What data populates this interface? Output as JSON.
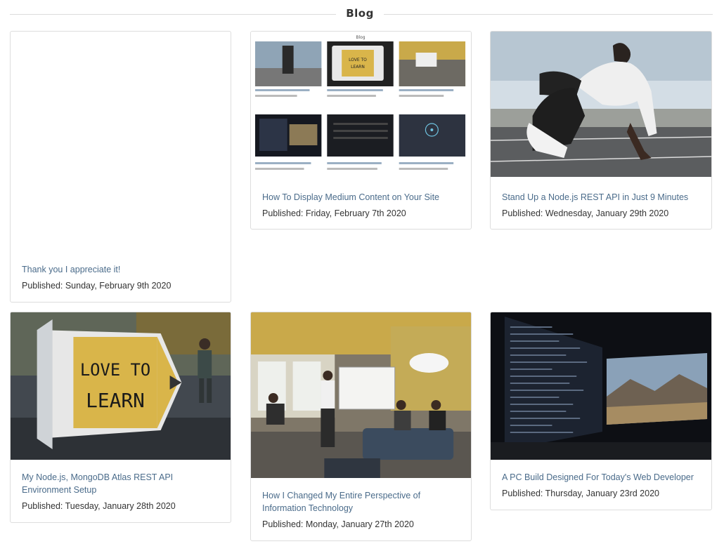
{
  "section": {
    "title": "Blog"
  },
  "posts": [
    {
      "title": "Thank you I appreciate it!",
      "published": "Published: Sunday, February 9th 2020",
      "image": "none"
    },
    {
      "title": "How To Display Medium Content on Your Site",
      "published": "Published: Friday, February 7th 2020",
      "image": "blog-grid-screenshot"
    },
    {
      "title": "Stand Up a Node.js REST API in Just 9 Minutes",
      "published": "Published: Wednesday, January 29th 2020",
      "image": "sprinter-on-track"
    },
    {
      "title": "My Node.js, MongoDB Atlas REST API Environment Setup",
      "published": "Published: Tuesday, January 28th 2020",
      "image": "love-to-learn-sign"
    },
    {
      "title": "How I Changed My Entire Perspective of Information Technology",
      "published": "Published: Monday, January 27th 2020",
      "image": "office-meeting"
    },
    {
      "title": "A PC Build Designed For Today's Web Developer",
      "published": "Published: Thursday, January 23rd 2020",
      "image": "dual-monitor-code"
    }
  ],
  "embedded_screenshot": {
    "heading": "Blog",
    "sign_text": "LOVE TO LEARN"
  },
  "sign": {
    "line1": "LOVE TO",
    "line2": "LEARN"
  },
  "colors": {
    "link": "#4a6b8a",
    "text": "#333333",
    "border": "#dddddd",
    "sign_yellow": "#d9b54a"
  }
}
